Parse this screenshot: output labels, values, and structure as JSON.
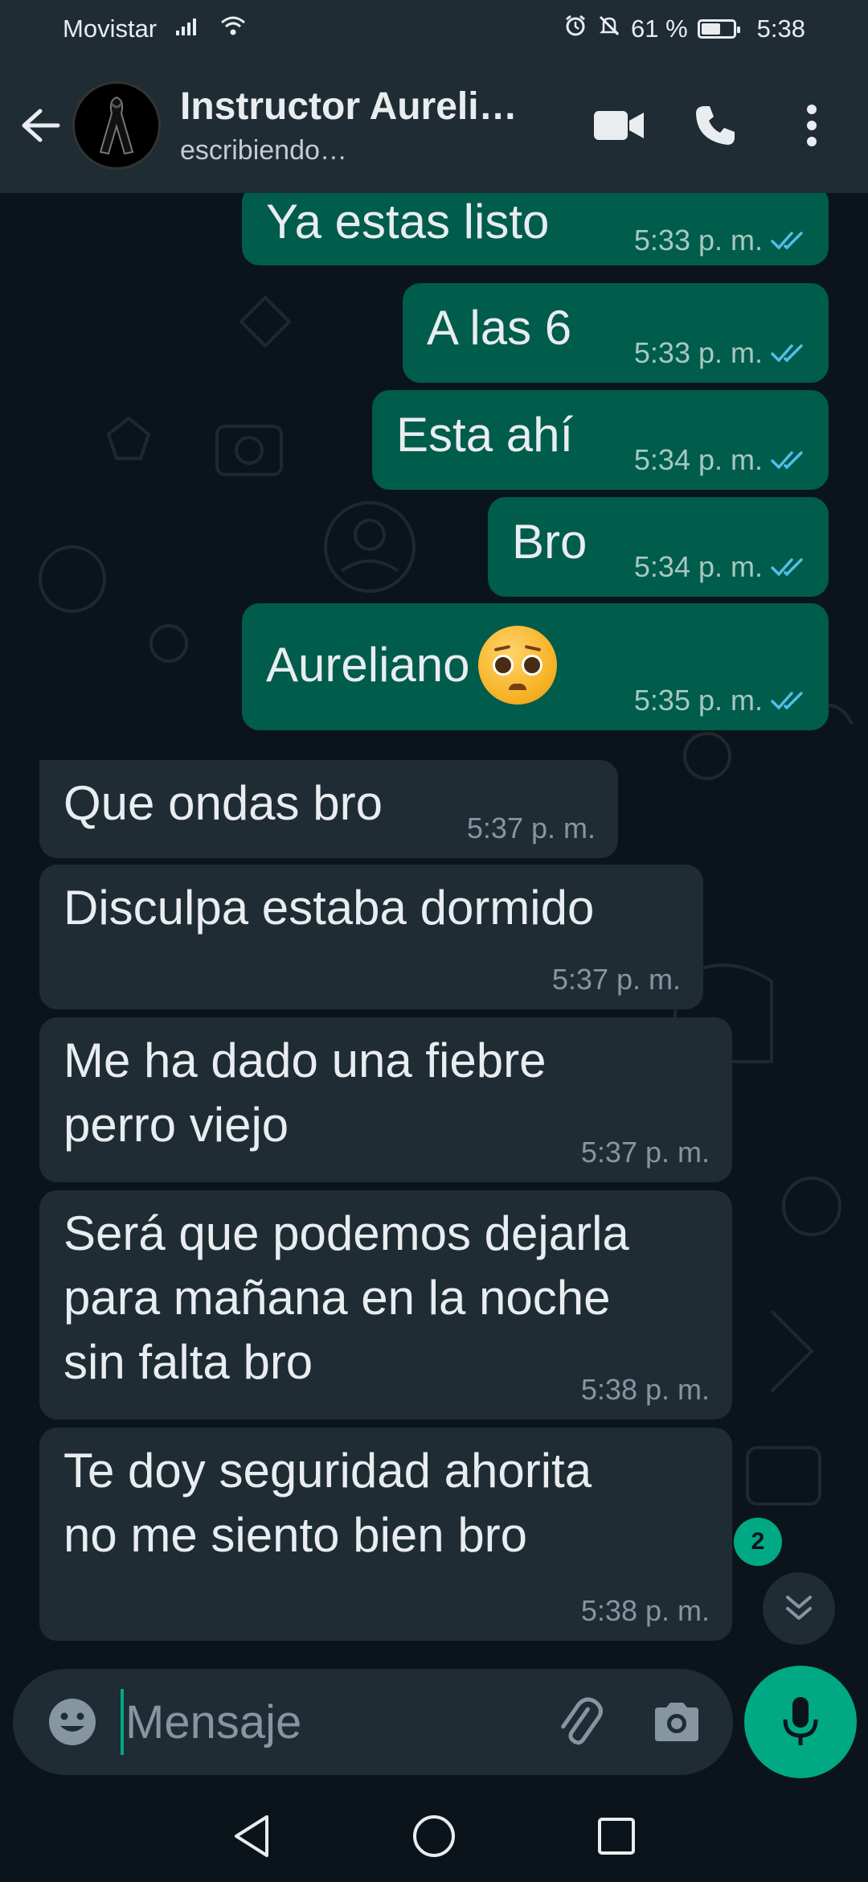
{
  "status_bar": {
    "carrier": "Movistar",
    "battery": "61 %",
    "battery_level": 0.61,
    "time": "5:38"
  },
  "header": {
    "contact_name": "Instructor Aureli…",
    "contact_status": "escribiendo…",
    "icons": [
      "back-arrow-icon",
      "video-call-icon",
      "phone-icon",
      "more-options-icon"
    ]
  },
  "messages": [
    {
      "direction": "out",
      "text": "Ya estas listo",
      "time": "5:33 p. m.",
      "ticks": "read"
    },
    {
      "direction": "out",
      "text": "A las 6",
      "time": "5:33 p. m.",
      "ticks": "read"
    },
    {
      "direction": "out",
      "text": "Esta ahí",
      "time": "5:34 p. m.",
      "ticks": "read"
    },
    {
      "direction": "out",
      "text": "Bro",
      "time": "5:34 p. m.",
      "ticks": "read"
    },
    {
      "direction": "out",
      "text": "Aureliano",
      "emoji": "pleading-face",
      "time": "5:35 p. m.",
      "ticks": "read"
    },
    {
      "direction": "in",
      "text": "Que ondas bro",
      "time": "5:37 p. m."
    },
    {
      "direction": "in",
      "text": "Disculpa estaba dormido",
      "time": "5:37 p. m."
    },
    {
      "direction": "in",
      "text": "Me ha dado una fiebre\nperro viejo",
      "time": "5:37 p. m."
    },
    {
      "direction": "in",
      "text": "Será que podemos dejarla\npara mañana en la noche\nsin falta bro",
      "time": "5:38 p. m."
    },
    {
      "direction": "in",
      "text": "Te doy seguridad ahorita\nno me siento bien bro",
      "time": "5:38 p. m."
    }
  ],
  "unread_count": "2",
  "input": {
    "placeholder": "Mensaje",
    "value": ""
  },
  "colors": {
    "background": "#0b141a",
    "header": "#1f2c34",
    "outgoing_bubble": "#005c4b",
    "incoming_bubble": "#1f2c34",
    "accent": "#00a884",
    "read_ticks": "#53bdeb"
  }
}
